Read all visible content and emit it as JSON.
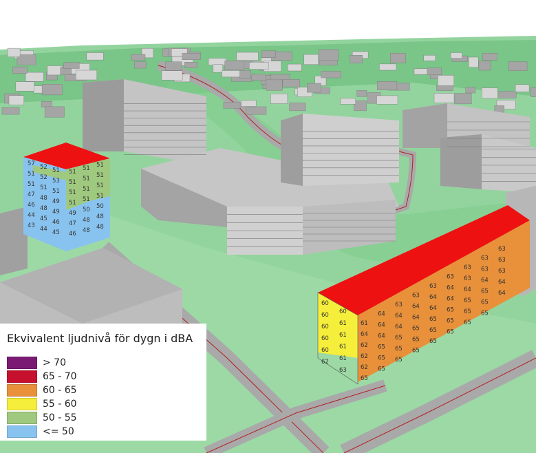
{
  "legend": {
    "title": "Ekvivalent ljudnivå för dygn i dBA",
    "classes": [
      {
        "label": "> 70",
        "color": "#7b1a73"
      },
      {
        "label": "65 - 70",
        "color": "#c7102e"
      },
      {
        "label": "60 - 65",
        "color": "#e8903a"
      },
      {
        "label": "55 - 60",
        "color": "#f5ee3a"
      },
      {
        "label": "50 - 55",
        "color": "#9fc97f"
      },
      {
        "label": "<= 50",
        "color": "#88c3ef"
      }
    ]
  },
  "colors": {
    "terrain": "#8fd19a",
    "terrain_dark": "#5aa86a",
    "building": "#b9b9b9",
    "building_roof": "#9a9a9a",
    "road": "#a8a8a8",
    "road_line": "#b02020",
    "roof_red": "#ee1111"
  },
  "facade_labels": {
    "tall_building": [
      "57",
      "52",
      "51",
      "51",
      "51",
      "51",
      "51",
      "52",
      "53",
      "51",
      "51",
      "51",
      "51",
      "51",
      "51",
      "51",
      "51",
      "51",
      "47",
      "48",
      "49",
      "51",
      "51",
      "51",
      "46",
      "48",
      "49",
      "49",
      "50",
      "50",
      "44",
      "45",
      "46",
      "47",
      "48",
      "48",
      "43",
      "44",
      "45",
      "46",
      "48",
      "48"
    ],
    "long_building": [
      "60",
      "60",
      "61",
      "64",
      "63",
      "63",
      "63",
      "63",
      "63",
      "63",
      "63",
      "60",
      "61",
      "64",
      "64",
      "64",
      "64",
      "64",
      "64",
      "63",
      "63",
      "63",
      "60",
      "61",
      "62",
      "64",
      "64",
      "64",
      "64",
      "64",
      "64",
      "64",
      "63",
      "60",
      "61",
      "62",
      "65",
      "65",
      "65",
      "65",
      "65",
      "65",
      "65",
      "64",
      "60",
      "61",
      "62",
      "65",
      "65",
      "65",
      "65",
      "65",
      "65",
      "65",
      "64",
      "62",
      "63",
      "65",
      "65",
      "65",
      "65",
      "65",
      "65",
      "65",
      "65"
    ]
  }
}
